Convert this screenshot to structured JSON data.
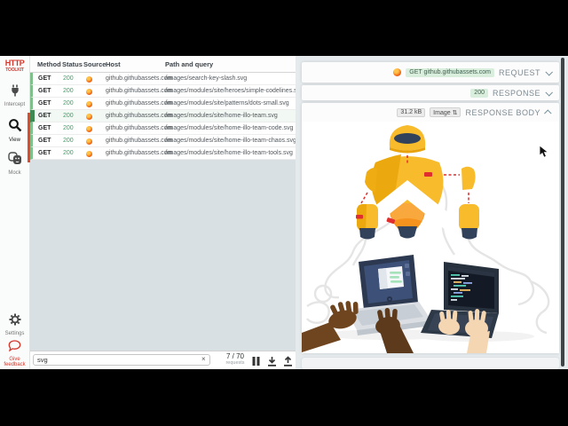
{
  "app": {
    "name": "HTTP Toolkit"
  },
  "sidebar": {
    "logo": {
      "line1": "HTTP",
      "line2": "TOOLKIT"
    },
    "nav": [
      {
        "label": "Intercept"
      },
      {
        "label": "View"
      },
      {
        "label": "Mock"
      }
    ],
    "footer_nav": [
      {
        "label": "Settings"
      },
      {
        "label": "Give feedback"
      }
    ]
  },
  "table": {
    "headers": {
      "method": "Method",
      "status": "Status",
      "source": "Source",
      "host": "Host",
      "path": "Path and query"
    },
    "rows": [
      {
        "method": "GET",
        "status": "200",
        "source": "firefox",
        "host": "github.githubassets.com",
        "path": "/images/search-key-slash.svg"
      },
      {
        "method": "GET",
        "status": "200",
        "source": "firefox",
        "host": "github.githubassets.com",
        "path": "/images/modules/site/heroes/simple-codelines.svg"
      },
      {
        "method": "GET",
        "status": "200",
        "source": "firefox",
        "host": "github.githubassets.com",
        "path": "/images/modules/site/patterns/dots-small.svg"
      },
      {
        "method": "GET",
        "status": "200",
        "source": "firefox",
        "host": "github.githubassets.com",
        "path": "/images/modules/site/home-illo-team.svg"
      },
      {
        "method": "GET",
        "status": "200",
        "source": "firefox",
        "host": "github.githubassets.com",
        "path": "/images/modules/site/home-illo-team-code.svg"
      },
      {
        "method": "GET",
        "status": "200",
        "source": "firefox",
        "host": "github.githubassets.com",
        "path": "/images/modules/site/home-illo-team-chaos.svg"
      },
      {
        "method": "GET",
        "status": "200",
        "source": "firefox",
        "host": "github.githubassets.com",
        "path": "/images/modules/site/home-illo-team-tools.svg"
      }
    ]
  },
  "footer": {
    "filter_value": "svg",
    "clear_icon": "×",
    "count": "7 / 70",
    "count_label": "requests"
  },
  "details": {
    "request": {
      "badge": "GET github.githubassets.com",
      "title": "REQUEST"
    },
    "response": {
      "badge": "200",
      "title": "RESPONSE"
    },
    "response_body": {
      "size": "31.2 kB",
      "format": "Image",
      "format_arrows": "⇅",
      "title": "RESPONSE BODY"
    }
  },
  "colors": {
    "brand_red": "#d6362a",
    "success_green": "#3f9e63",
    "row_border_green": "#7fc08d",
    "selected_border_green": "#3f8a53",
    "badge_green_bg": "#d9eedd",
    "scrollbar": "#3f4446"
  }
}
